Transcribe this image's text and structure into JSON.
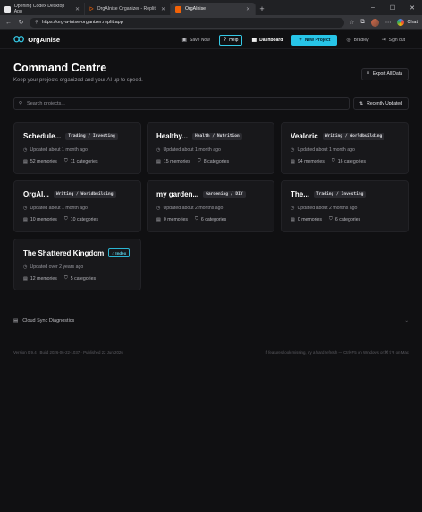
{
  "browser": {
    "tabs": [
      {
        "title": "Opening Codex Desktop App",
        "color": "#e8e8ea"
      },
      {
        "title": "OrgAInise Organizer - Replit",
        "color": "#f26207"
      },
      {
        "title": "OrgAInise",
        "color": "#f26207"
      }
    ],
    "new_tab": "+",
    "url": "https://org-a-inise-organizer.replit.app",
    "chat_label": "Chat",
    "win_controls": [
      "–",
      "☐",
      "✕"
    ]
  },
  "header": {
    "logo_text": "OrgAInise",
    "logo_mark": "Ꝏ",
    "save_now": "Save Now",
    "help": "Help",
    "dashboard": "Dashboard",
    "new_project": "New Project",
    "user": "Bradley",
    "sign_out": "Sign out",
    "accent": "#27c5e8"
  },
  "page": {
    "title": "Command Centre",
    "subtitle": "Keep your projects organized and your AI up to speed.",
    "export_label": "Export All Data",
    "search_placeholder": "Search projects...",
    "sort_label": "Recently Updated"
  },
  "projects": [
    {
      "title": "Schedule...",
      "tag": "Trading / Investing",
      "updated": "Updated about 1 month ago",
      "memories": "52 memories",
      "categories": "11 categories"
    },
    {
      "title": "Healthy...",
      "tag": "Health / Nutrition",
      "updated": "Updated about 1 month ago",
      "memories": "15 memories",
      "categories": "8 categories"
    },
    {
      "title": "Vealoric",
      "tag": "Writing / Worldbuilding",
      "updated": "Updated about 1 month ago",
      "memories": "94 memories",
      "categories": "16 categories"
    },
    {
      "title": "OrgAI...",
      "tag": "Writing / Worldbuilding",
      "updated": "Updated about 1 month ago",
      "memories": "10 memories",
      "categories": "10 categories"
    },
    {
      "title": "my garden...",
      "tag": "Gardening / DIY",
      "updated": "Updated about 2 months ago",
      "memories": "0 memories",
      "categories": "6 categories"
    },
    {
      "title": "The...",
      "tag": "Trading / Investing",
      "updated": "Updated about 2 months ago",
      "memories": "0 memories",
      "categories": "6 categories"
    },
    {
      "title": "The Shattered Kingdom",
      "tag": "Index",
      "updated": "Updated over 2 years ago",
      "memories": "12 memories",
      "categories": "5 categories"
    }
  ],
  "diagnostics": {
    "label": "Cloud Sync Diagnostics"
  },
  "footer": {
    "version": "Version 0.9.4 · Build 2026-06-22-1037 · Published 22 Jun 2026",
    "hint": "If features look missing, try a hard refresh — Ctrl+F5 on Windows or ⌘⇧R on Mac"
  }
}
